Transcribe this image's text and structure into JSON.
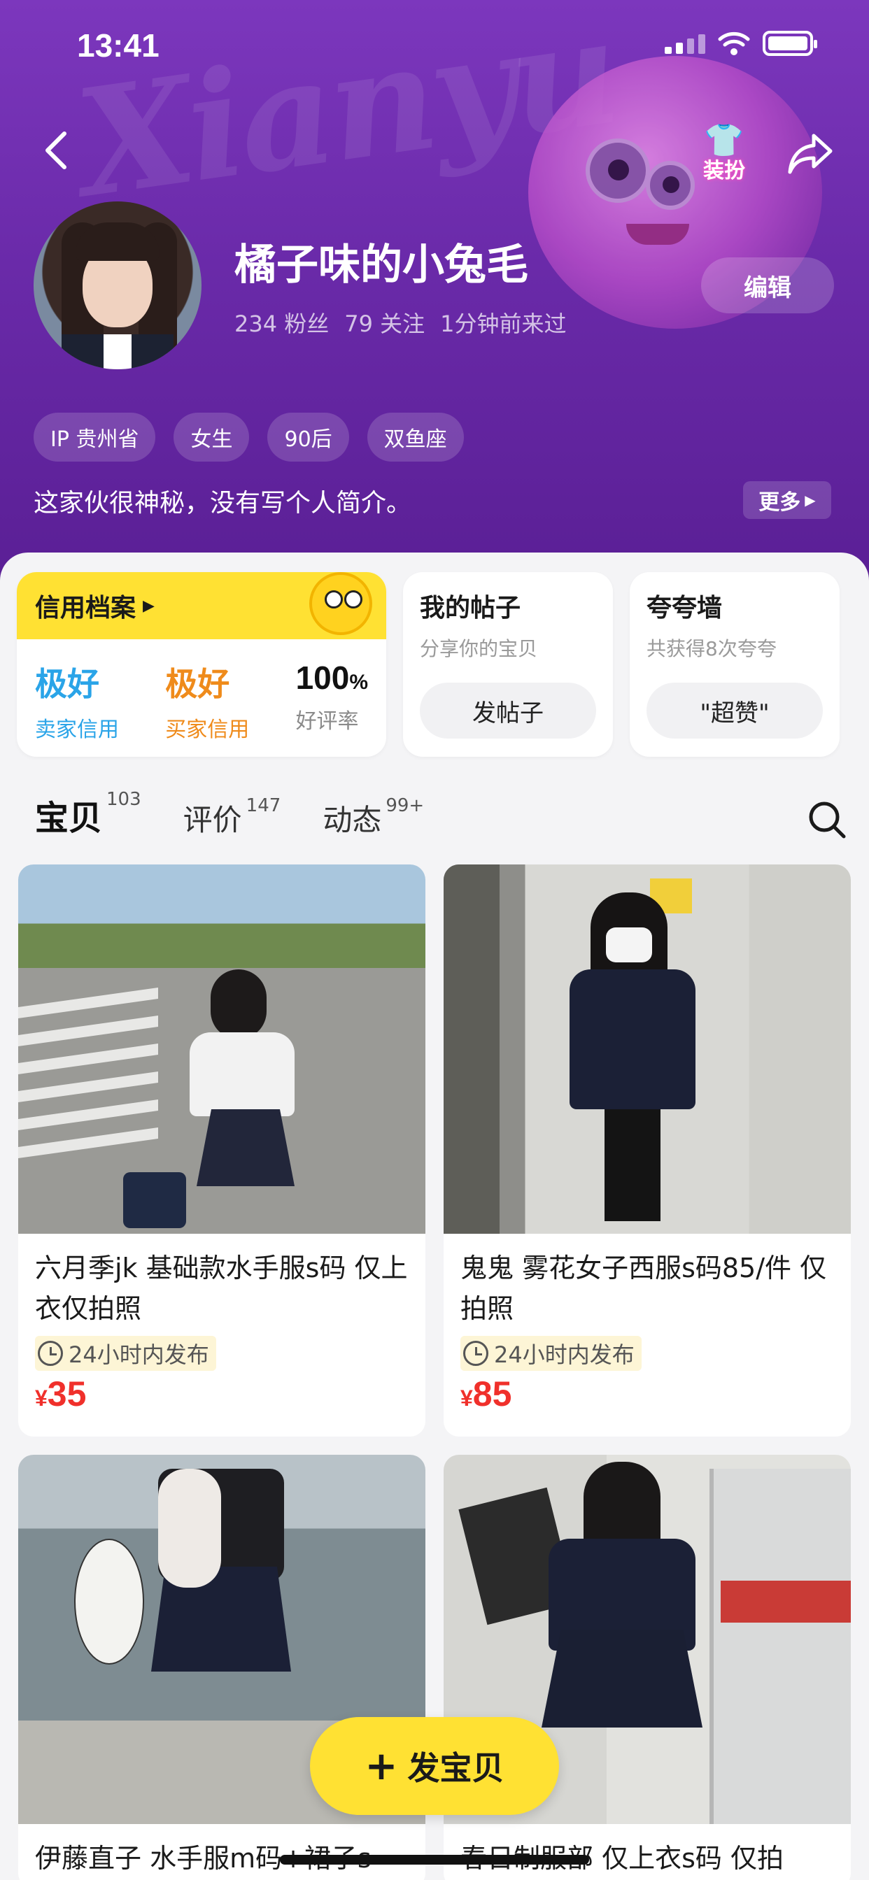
{
  "status_bar": {
    "time": "13:41"
  },
  "header": {
    "watermark": "Xianyu",
    "dress_up_label": "装扮",
    "name": "橘子味的小兔毛",
    "stats": {
      "fans": "234 粉丝",
      "following": "79 关注",
      "last_seen": "1分钟前来过"
    },
    "edit_label": "编辑",
    "tags": [
      "IP 贵州省",
      "女生",
      "90后",
      "双鱼座"
    ],
    "bio": "这家伙很神秘，没有写个人简介。",
    "more_label": "更多"
  },
  "credit": {
    "title": "信用档案",
    "seller_grade": "极好",
    "seller_label": "卖家信用",
    "buyer_grade": "极好",
    "buyer_label": "买家信用",
    "rating_value": "100",
    "rating_unit": "%",
    "rating_label": "好评率"
  },
  "posts": {
    "title": "我的帖子",
    "subtitle": "分享你的宝贝",
    "button": "发帖子"
  },
  "praise_wall": {
    "title": "夸夸墙",
    "subtitle": "共获得8次夸夸",
    "button": "\"超赞\""
  },
  "tabs": [
    {
      "label": "宝贝",
      "count": "103"
    },
    {
      "label": "评价",
      "count": "147"
    },
    {
      "label": "动态",
      "count": "99+"
    }
  ],
  "items": [
    {
      "title": "六月季jk 基础款水手服s码 仅上衣仅拍照",
      "badge": "24小时内发布",
      "currency": "¥",
      "price": "35"
    },
    {
      "title": "鬼鬼 雾花女子西服s码85/件 仅拍照",
      "badge": "24小时内发布",
      "currency": "¥",
      "price": "85"
    },
    {
      "title": "伊藤直子 水手服m码+裙子s"
    },
    {
      "title": "春日制服部 仅上衣s码 仅拍"
    }
  ],
  "fab": {
    "label": "发宝贝"
  },
  "colors": {
    "brand_yellow": "#ffe133",
    "header_purple": "#6a2aa9",
    "price_red": "#f0302b",
    "seller_blue": "#2aa4e8",
    "buyer_orange": "#ef8b1b"
  }
}
